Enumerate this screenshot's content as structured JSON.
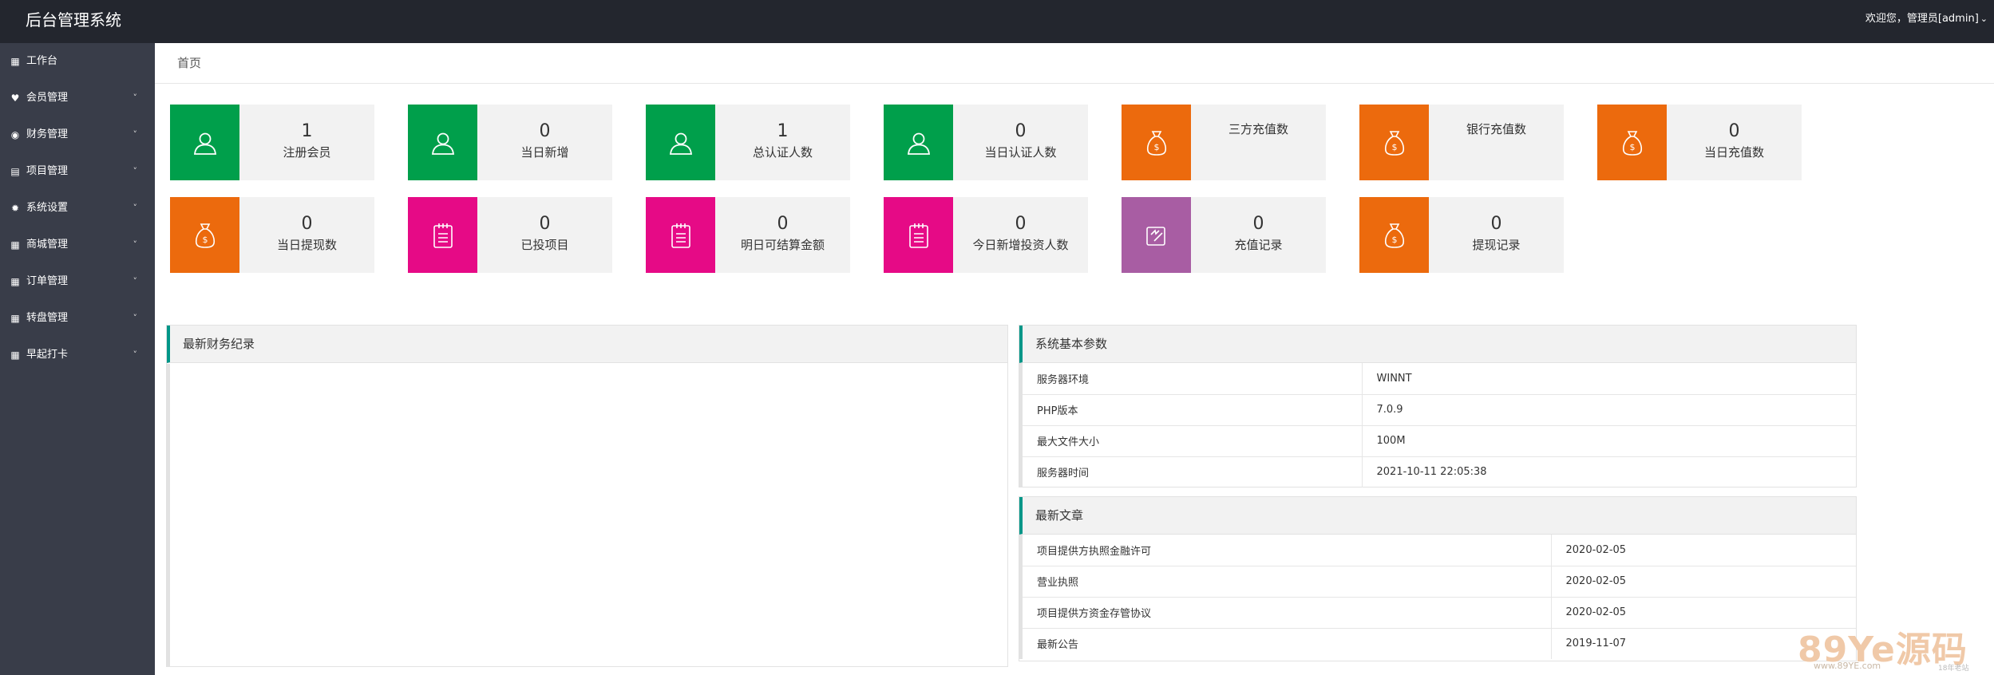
{
  "header": {
    "brand": "后台管理系统",
    "user_greeting": "欢迎您，管理员[admin]"
  },
  "sidebar": {
    "items": [
      {
        "label": "工作台",
        "icon": "dashboard-icon",
        "expandable": false
      },
      {
        "label": "会员管理",
        "icon": "member-icon",
        "expandable": true
      },
      {
        "label": "财务管理",
        "icon": "finance-icon",
        "expandable": true
      },
      {
        "label": "项目管理",
        "icon": "project-icon",
        "expandable": true
      },
      {
        "label": "系统设置",
        "icon": "gear-icon",
        "expandable": true
      },
      {
        "label": "商城管理",
        "icon": "shop-icon",
        "expandable": true
      },
      {
        "label": "订单管理",
        "icon": "order-icon",
        "expandable": true
      },
      {
        "label": "转盘管理",
        "icon": "wheel-icon",
        "expandable": true
      },
      {
        "label": "早起打卡",
        "icon": "checkin-icon",
        "expandable": true
      }
    ]
  },
  "tabs": {
    "home": "首页"
  },
  "cards": [
    {
      "value": "1",
      "label": "注册会员",
      "color": "#009f4b",
      "icon": "user-icon"
    },
    {
      "value": "0",
      "label": "当日新增",
      "color": "#009f4b",
      "icon": "user-icon"
    },
    {
      "value": "1",
      "label": "总认证人数",
      "color": "#009f4b",
      "icon": "user-icon"
    },
    {
      "value": "0",
      "label": "当日认证人数",
      "color": "#009f4b",
      "icon": "user-icon"
    },
    {
      "value": "",
      "label": "三方充值数",
      "color": "#ec6a0d",
      "icon": "money-bag-icon"
    },
    {
      "value": "",
      "label": "银行充值数",
      "color": "#ec6a0d",
      "icon": "money-bag-icon"
    },
    {
      "value": "0",
      "label": "当日充值数",
      "color": "#ec6a0d",
      "icon": "money-bag-icon"
    },
    {
      "value": "0",
      "label": "当日提现数",
      "color": "#ec6a0d",
      "icon": "money-bag-icon"
    },
    {
      "value": "0",
      "label": "已投项目",
      "color": "#e60a86",
      "icon": "clipboard-icon"
    },
    {
      "value": "0",
      "label": "明日可结算金额",
      "color": "#e60a86",
      "icon": "clipboard-icon"
    },
    {
      "value": "0",
      "label": "今日新增投资人数",
      "color": "#e60a86",
      "icon": "clipboard-icon"
    },
    {
      "value": "0",
      "label": "充值记录",
      "color": "#a85da3",
      "icon": "recharge-icon"
    },
    {
      "value": "0",
      "label": "提现记录",
      "color": "#ec6a0d",
      "icon": "money-bag-icon"
    }
  ],
  "finance_panel": {
    "title": "最新财务纪录"
  },
  "system_panel": {
    "title": "系统基本参数",
    "rows": [
      {
        "key": "服务器环境",
        "value": "WINNT"
      },
      {
        "key": "PHP版本",
        "value": "7.0.9"
      },
      {
        "key": "最大文件大小",
        "value": "100M"
      },
      {
        "key": "服务器时间",
        "value": "2021-10-11 22:05:38"
      }
    ]
  },
  "articles_panel": {
    "title": "最新文章",
    "rows": [
      {
        "title": "项目提供方执照金融许可",
        "date": "2020-02-05"
      },
      {
        "title": "营业执照",
        "date": "2020-02-05"
      },
      {
        "title": "项目提供方资金存管协议",
        "date": "2020-02-05"
      },
      {
        "title": "最新公告",
        "date": "2019-11-07"
      }
    ]
  },
  "watermark": {
    "logo": "89Ye源码",
    "url": "www.89YE.com",
    "tag": "18年老站"
  }
}
